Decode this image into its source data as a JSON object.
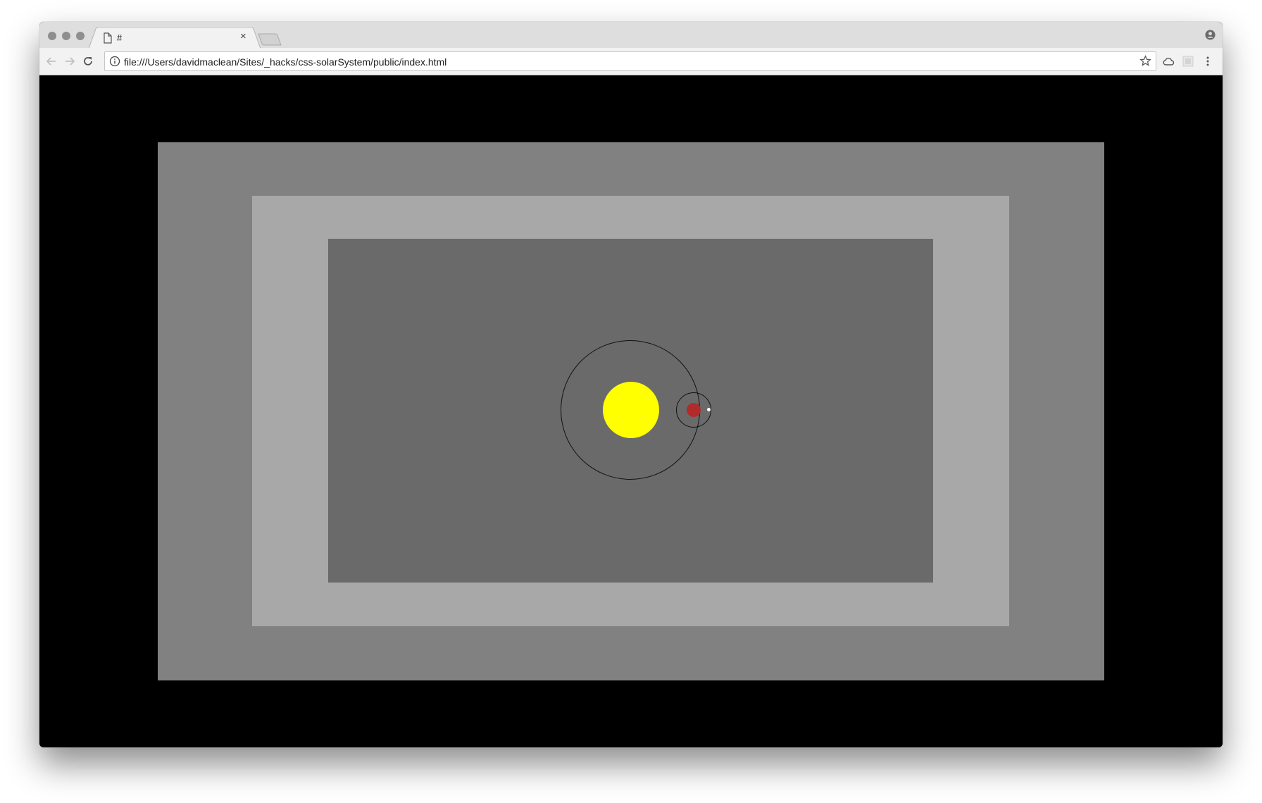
{
  "browser": {
    "tab": {
      "title": "#",
      "close_glyph": "×"
    },
    "address_bar": {
      "url": "file:///Users/davidmaclean/Sites/_hacks/css-solarSystem/public/index.html"
    },
    "icons": {
      "back": "back-arrow-icon",
      "forward": "forward-arrow-icon",
      "reload": "reload-icon",
      "info": "info-icon",
      "bookmark": "star-icon",
      "cloud": "cloud-icon",
      "extension": "extension-icon",
      "menu": "menu-icon",
      "profile": "profile-icon"
    }
  },
  "page": {
    "colors": {
      "background": "#000000",
      "outer_rect": "#818181",
      "middle_rect": "#a8a8a8",
      "inner_rect": "#6a6a6a",
      "sun": "#ffff00",
      "planet": "#b22b2b",
      "moon": "#ffffff",
      "orbit_line": "#111111"
    }
  }
}
